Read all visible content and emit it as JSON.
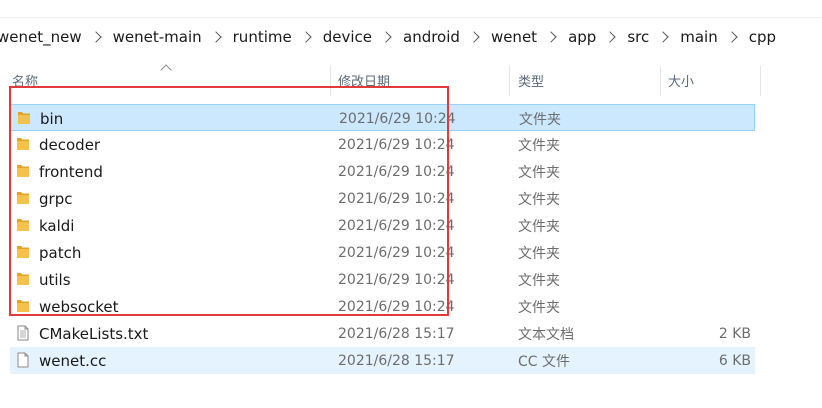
{
  "breadcrumb": [
    "wenet_new",
    "wenet-main",
    "runtime",
    "device",
    "android",
    "wenet",
    "app",
    "src",
    "main",
    "cpp"
  ],
  "columns": {
    "name": "名称",
    "modified": "修改日期",
    "type": "类型",
    "size": "大小"
  },
  "files": [
    {
      "name": "bin",
      "modified": "2021/6/29 10:24",
      "type": "文件夹",
      "size": "",
      "icon": "folder-icon",
      "selected": true
    },
    {
      "name": "decoder",
      "modified": "2021/6/29 10:24",
      "type": "文件夹",
      "size": "",
      "icon": "folder-icon"
    },
    {
      "name": "frontend",
      "modified": "2021/6/29 10:24",
      "type": "文件夹",
      "size": "",
      "icon": "folder-icon"
    },
    {
      "name": "grpc",
      "modified": "2021/6/29 10:24",
      "type": "文件夹",
      "size": "",
      "icon": "folder-icon"
    },
    {
      "name": "kaldi",
      "modified": "2021/6/29 10:24",
      "type": "文件夹",
      "size": "",
      "icon": "folder-icon"
    },
    {
      "name": "patch",
      "modified": "2021/6/29 10:24",
      "type": "文件夹",
      "size": "",
      "icon": "folder-icon"
    },
    {
      "name": "utils",
      "modified": "2021/6/29 10:24",
      "type": "文件夹",
      "size": "",
      "icon": "folder-icon"
    },
    {
      "name": "websocket",
      "modified": "2021/6/29 10:24",
      "type": "文件夹",
      "size": "",
      "icon": "folder-icon"
    },
    {
      "name": "CMakeLists.txt",
      "modified": "2021/6/28 15:17",
      "type": "文本文档",
      "size": "2 KB",
      "icon": "text-file-icon"
    },
    {
      "name": "wenet.cc",
      "modified": "2021/6/28 15:17",
      "type": "CC 文件",
      "size": "6 KB",
      "icon": "file-icon",
      "hover": true
    }
  ],
  "colors": {
    "selection": "#cce8ff",
    "selection_border": "#99d1ff",
    "hover": "#e5f3ff",
    "highlight_box": "#e03a3a",
    "folder": "#f2c14e"
  }
}
